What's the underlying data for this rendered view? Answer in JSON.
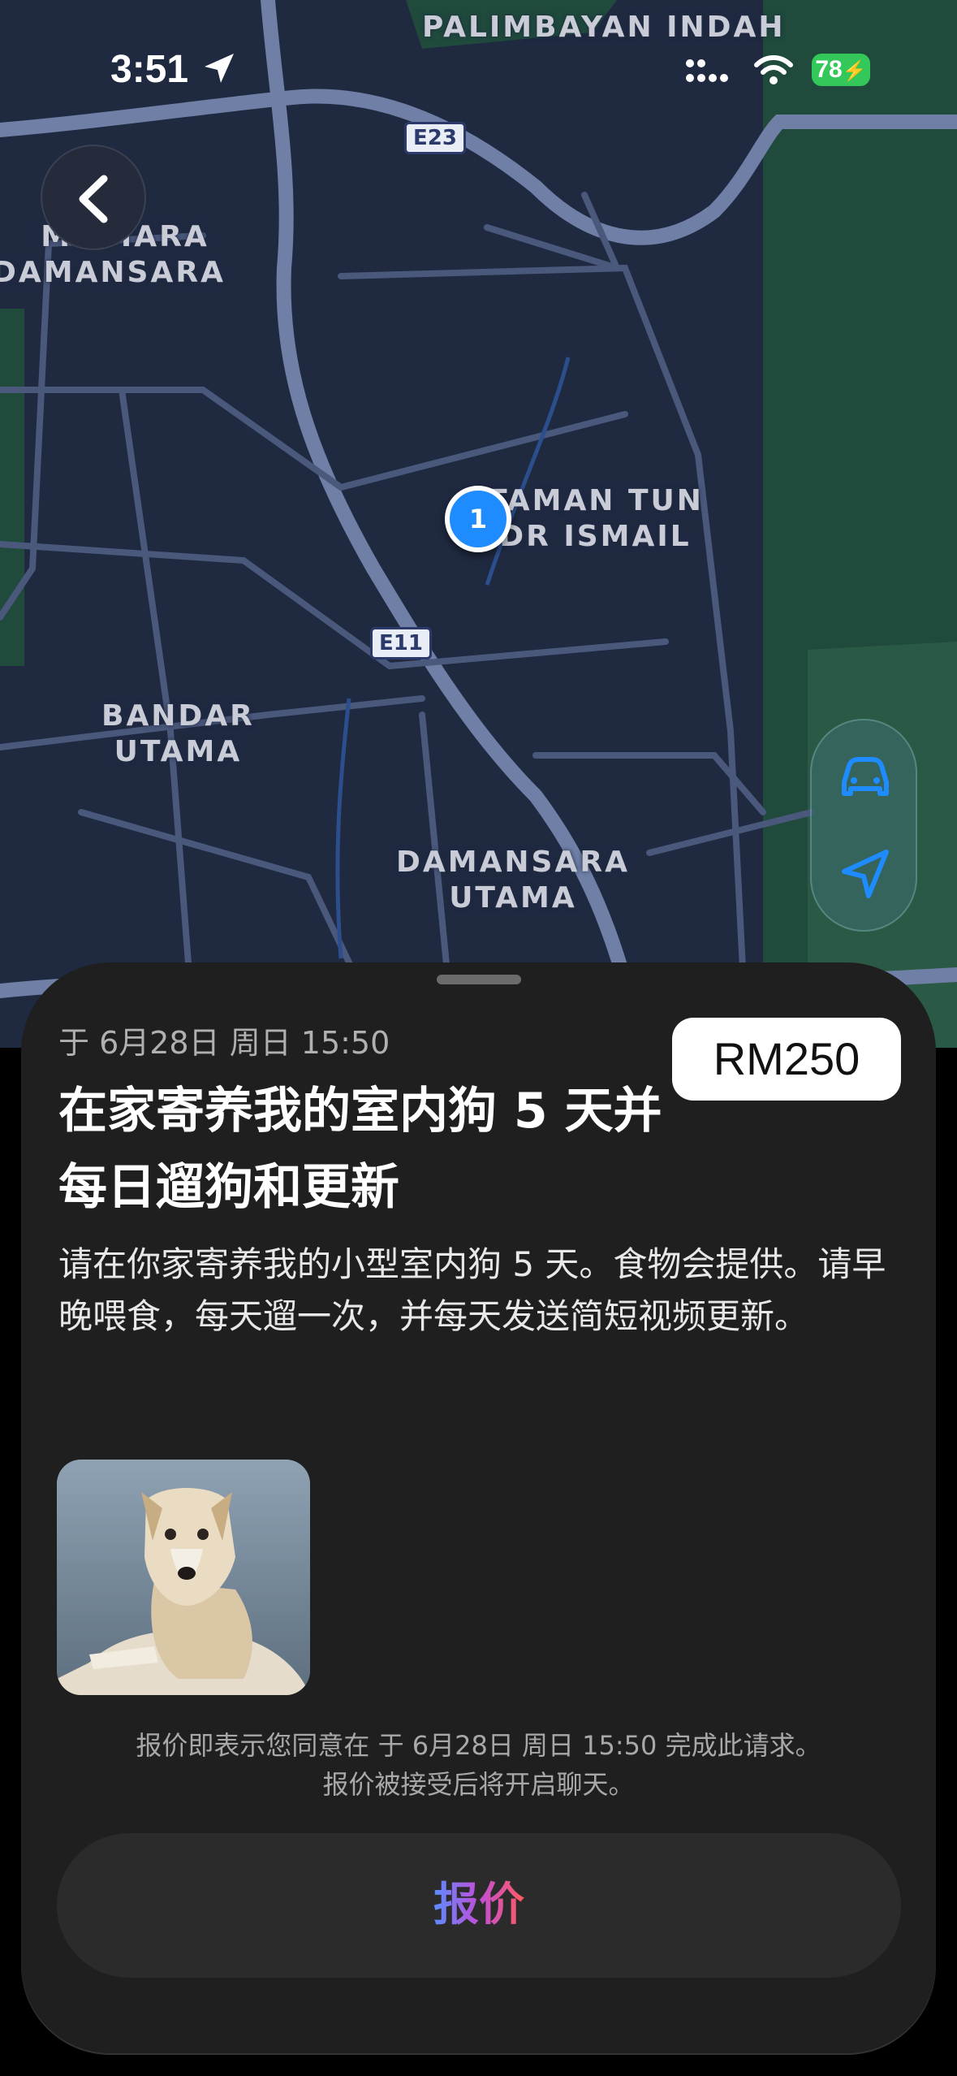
{
  "status_bar": {
    "time": "3:51",
    "battery": "78"
  },
  "map": {
    "labels": {
      "palimbayan": "PALIMBAYAN INDAH",
      "mutiara_1": "MUTIARA",
      "mutiara_2": "DAMANSARA",
      "ttdi_1": "TAMAN TUN",
      "ttdi_2": "DR ISMAIL",
      "bandar_1": "BANDAR",
      "bandar_2": "UTAMA",
      "damansara_1": "DAMANSARA",
      "damansara_2": "UTAMA"
    },
    "shields": {
      "e23": "E23",
      "e11": "E11"
    },
    "pin_count": "1"
  },
  "request": {
    "date": "于 6月28日 周日 15:50",
    "price": "RM250",
    "title": "在家寄养我的室内狗 5 天并每日遛狗和更新",
    "description": "请在你家寄养我的小型室内狗 5 天。食物会提供。请早晚喂食，每天遛一次，并每天发送简短视频更新。",
    "footnote_line1": "报价即表示您同意在 于 6月28日 周日 15:50 完成此请求。",
    "footnote_line2": "报价被接受后将开启聊天。",
    "offer_label": "报价"
  },
  "colors": {
    "accent_blue": "#1e8bff",
    "battery_green": "#34c759",
    "map_bg": "#1f2940"
  }
}
